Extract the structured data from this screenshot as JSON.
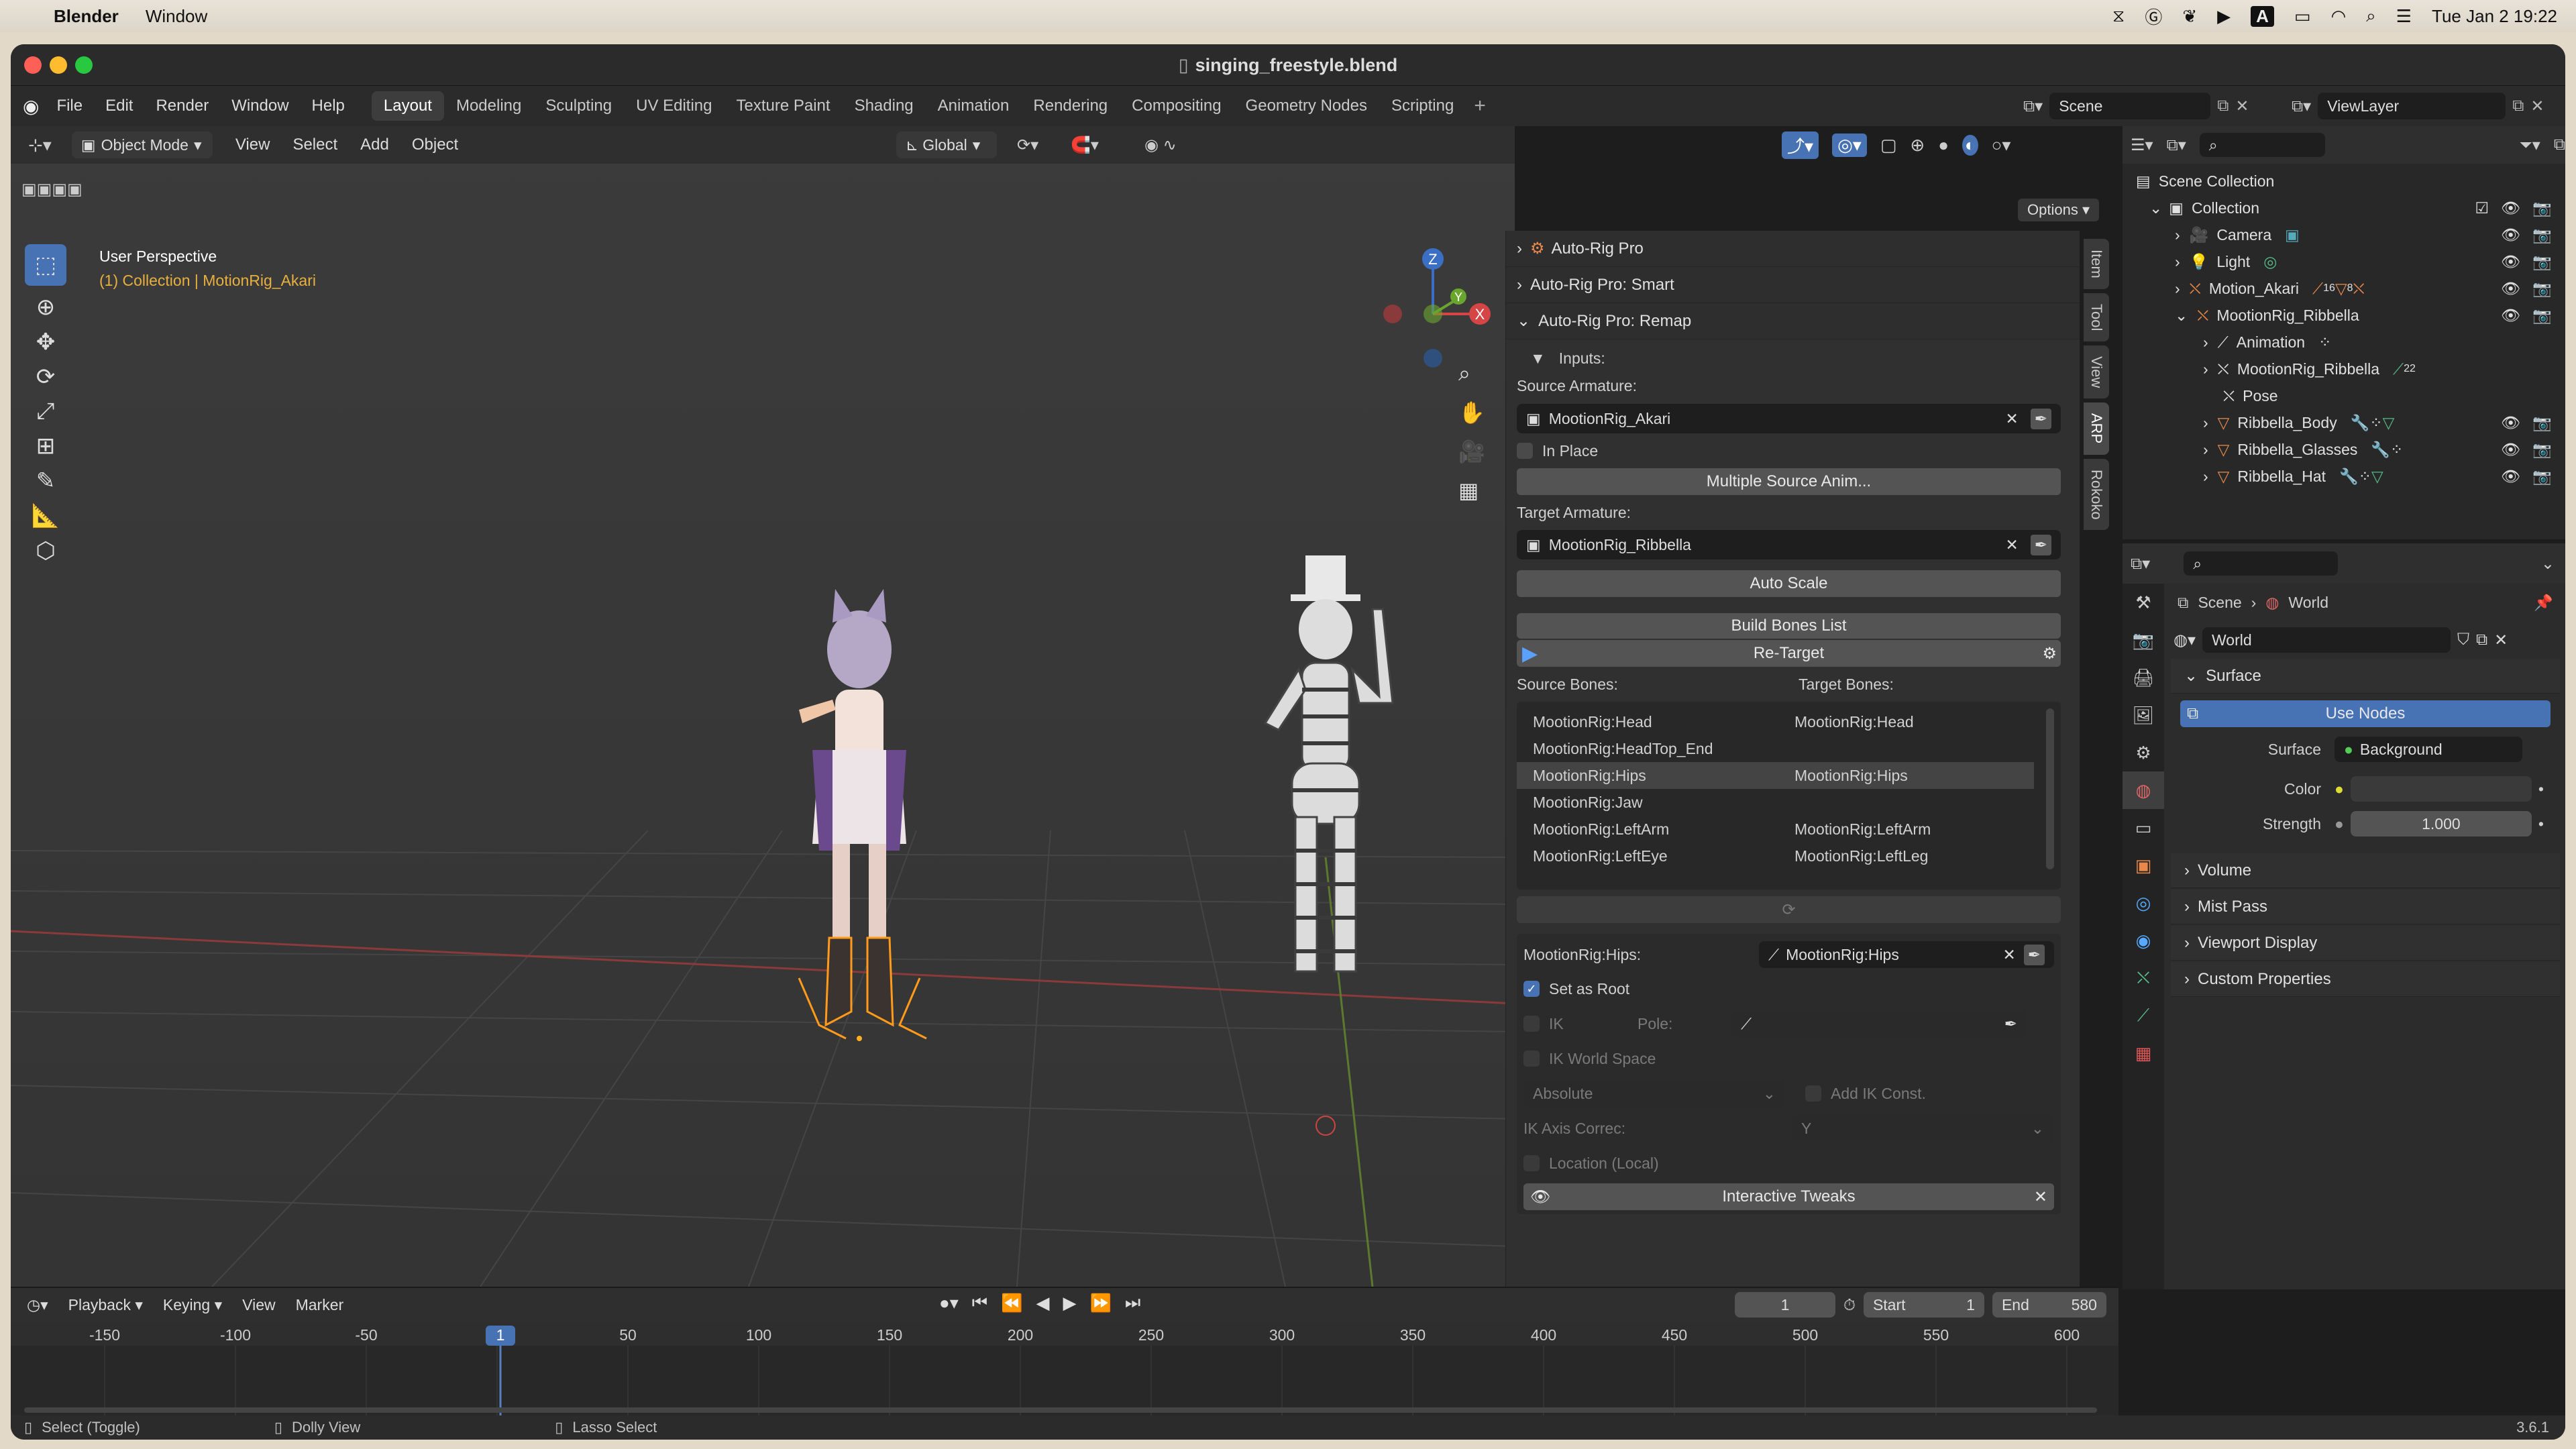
{
  "macmenu": {
    "app": "Blender",
    "window": "Window",
    "clock": "Tue Jan 2  19:22",
    "input_badge": "A"
  },
  "window": {
    "title": "singing_freestyle.blend"
  },
  "menus": [
    "File",
    "Edit",
    "Render",
    "Window",
    "Help"
  ],
  "workspaces": [
    "Layout",
    "Modeling",
    "Sculpting",
    "UV Editing",
    "Texture Paint",
    "Shading",
    "Animation",
    "Rendering",
    "Compositing",
    "Geometry Nodes",
    "Scripting"
  ],
  "active_workspace": "Layout",
  "scene_field": "Scene",
  "viewlayer_field": "ViewLayer",
  "viewport": {
    "mode": "Object Mode",
    "menus": [
      "View",
      "Select",
      "Add",
      "Object"
    ],
    "transform": "Global",
    "options": "Options",
    "overlay_title": "User Perspective",
    "overlay_sub": "(1) Collection | MotionRig_Akari",
    "gizmo": {
      "x": "X",
      "y": "Y",
      "z": "Z"
    }
  },
  "npanel": {
    "panels": [
      "Auto-Rig Pro",
      "Auto-Rig Pro: Smart",
      "Auto-Rig Pro: Remap"
    ],
    "inputs": "Inputs:",
    "source_armature_label": "Source Armature:",
    "source_armature": "MootionRig_Akari",
    "in_place": "In Place",
    "multiple_source": "Multiple Source Anim...",
    "target_armature_label": "Target Armature:",
    "target_armature": "MootionRig_Ribbella",
    "auto_scale": "Auto Scale",
    "build_bones": "Build Bones List",
    "retarget": "Re-Target",
    "source_bones_label": "Source Bones:",
    "target_bones_label": "Target Bones:",
    "bones": [
      {
        "src": "MootionRig:Head",
        "tgt": "MootionRig:Head"
      },
      {
        "src": "MootionRig:HeadTop_End",
        "tgt": ""
      },
      {
        "src": "MootionRig:Hips",
        "tgt": "MootionRig:Hips"
      },
      {
        "src": "MootionRig:Jaw",
        "tgt": ""
      },
      {
        "src": "MootionRig:LeftArm",
        "tgt": "MootionRig:LeftArm"
      },
      {
        "src": "MootionRig:LeftEye",
        "tgt": "MootionRig:LeftLeg"
      }
    ],
    "selected_bone_label": "MootionRig:Hips:",
    "selected_bone_value": "MootionRig:Hips",
    "set_as_root": "Set as Root",
    "ik": "IK",
    "pole": "Pole:",
    "ik_world_space": "IK World Space",
    "absolute": "Absolute",
    "add_ik_const": "Add IK Const.",
    "ik_axis_correc": "IK Axis Correc:",
    "ik_axis_value": "Y",
    "location_local": "Location (Local)",
    "interactive_tweaks": "Interactive Tweaks"
  },
  "sidetabs": [
    "Item",
    "Tool",
    "View",
    "ARP",
    "Rokoko"
  ],
  "outliner": {
    "scene_collection": "Scene Collection",
    "rows": [
      {
        "label": "Collection",
        "indent": 0
      },
      {
        "label": "Camera",
        "indent": 1
      },
      {
        "label": "Light",
        "indent": 1
      },
      {
        "label": "Motion_Akari",
        "indent": 1
      },
      {
        "label": "MootionRig_Ribbella",
        "indent": 1
      },
      {
        "label": "Animation",
        "indent": 2
      },
      {
        "label": "MootionRig_Ribbella",
        "indent": 2
      },
      {
        "label": "Pose",
        "indent": 2
      },
      {
        "label": "Ribbella_Body",
        "indent": 2
      },
      {
        "label": "Ribbella_Glasses",
        "indent": 2
      },
      {
        "label": "Ribbella_Hat",
        "indent": 2
      }
    ],
    "akari_badge_a": "16",
    "akari_badge_b": "8",
    "ribbella_badge": "22"
  },
  "properties": {
    "breadcrumb_scene": "Scene",
    "breadcrumb_world": "World",
    "world_field": "World",
    "surface_section": "Surface",
    "use_nodes": "Use Nodes",
    "surface_label": "Surface",
    "surface_value": "Background",
    "color_label": "Color",
    "strength_label": "Strength",
    "strength_value": "1.000",
    "sections": [
      "Volume",
      "Mist Pass",
      "Viewport Display",
      "Custom Properties"
    ]
  },
  "timeline": {
    "menus": [
      "Playback",
      "Keying",
      "View",
      "Marker"
    ],
    "current_frame": "1",
    "start_label": "Start",
    "start": "1",
    "end_label": "End",
    "end": "580",
    "ruler": [
      "-150",
      "-100",
      "-50",
      "1",
      "50",
      "100",
      "150",
      "200",
      "250",
      "300",
      "350",
      "400",
      "450",
      "500",
      "550",
      "600"
    ]
  },
  "status": {
    "select": "Select (Toggle)",
    "dolly": "Dolly View",
    "lasso": "Lasso Select",
    "version": "3.6.1"
  }
}
